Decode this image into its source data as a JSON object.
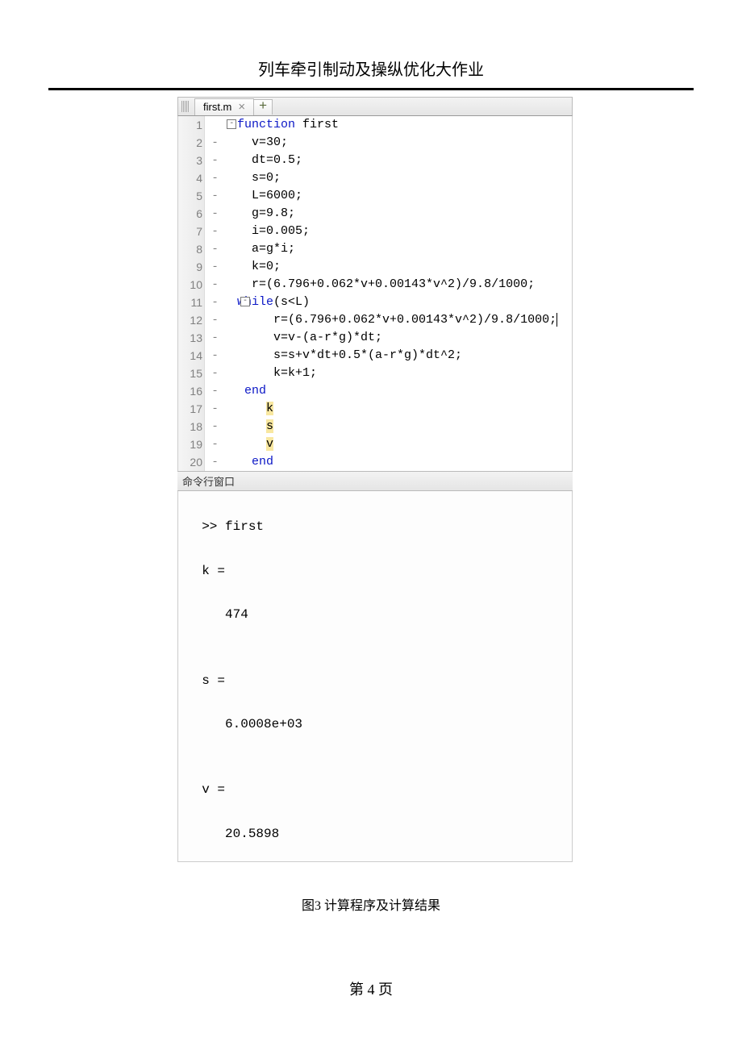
{
  "header": {
    "title": "列车牵引制动及操纵优化大作业"
  },
  "tab": {
    "filename": "first.m",
    "close": "×",
    "plus": "+"
  },
  "code": {
    "lines": [
      {
        "n": "1",
        "g": "",
        "fold": "-",
        "pre": "",
        "kw": "function",
        "rest": " first"
      },
      {
        "n": "2",
        "g": " -",
        "pre": "  ",
        "rest": "v=30;"
      },
      {
        "n": "3",
        "g": " -",
        "pre": "  ",
        "rest": "dt=0.5;"
      },
      {
        "n": "4",
        "g": " -",
        "pre": "  ",
        "rest": "s=0;"
      },
      {
        "n": "5",
        "g": " -",
        "pre": "  ",
        "rest": "L=6000;"
      },
      {
        "n": "6",
        "g": " -",
        "pre": "  ",
        "rest": "g=9.8;"
      },
      {
        "n": "7",
        "g": " -",
        "pre": "  ",
        "rest": "i=0.005;"
      },
      {
        "n": "8",
        "g": " -",
        "pre": "  ",
        "rest": "a=g*i;"
      },
      {
        "n": "9",
        "g": " -",
        "pre": "  ",
        "rest": "k=0;"
      },
      {
        "n": "10",
        "g": " -",
        "pre": "  ",
        "rest": "r=(6.796+0.062*v+0.00143*v^2)/9.8/1000;"
      },
      {
        "n": "11",
        "g": " -",
        "fold": "-",
        "pre": "",
        "kw": "while",
        "rest": "(s<L)"
      },
      {
        "n": "12",
        "g": " -",
        "pre": "     ",
        "rest": "r=(6.796+0.062*v+0.00143*v^2)/9.8/1000;",
        "cursor": true
      },
      {
        "n": "13",
        "g": " -",
        "pre": "     ",
        "rest": "v=v-(a-r*g)*dt;"
      },
      {
        "n": "14",
        "g": " -",
        "pre": "     ",
        "rest": "s=s+v*dt+0.5*(a-r*g)*dt^2;"
      },
      {
        "n": "15",
        "g": " -",
        "pre": "     ",
        "rest": "k=k+1;"
      },
      {
        "n": "16",
        "g": " -",
        "pre": " ",
        "kw": "end",
        "rest": ""
      },
      {
        "n": "17",
        "g": " -",
        "pre": "    ",
        "hl": "k",
        "rest": ""
      },
      {
        "n": "18",
        "g": " -",
        "pre": "    ",
        "hl": "s",
        "rest": ""
      },
      {
        "n": "19",
        "g": " -",
        "pre": "    ",
        "hl": "v",
        "rest": ""
      },
      {
        "n": "20",
        "g": " -",
        "pre": "  ",
        "kw": "end",
        "rest": ""
      }
    ]
  },
  "command_window": {
    "label": "命令行窗口"
  },
  "output": {
    "cmd": ">> first",
    "k_label": "k =",
    "k_val": "474",
    "s_label": "s =",
    "s_val": "6.0008e+03",
    "v_label": "v =",
    "v_val": "20.5898"
  },
  "caption": "图3  计算程序及计算结果",
  "footer": "第 4 页"
}
